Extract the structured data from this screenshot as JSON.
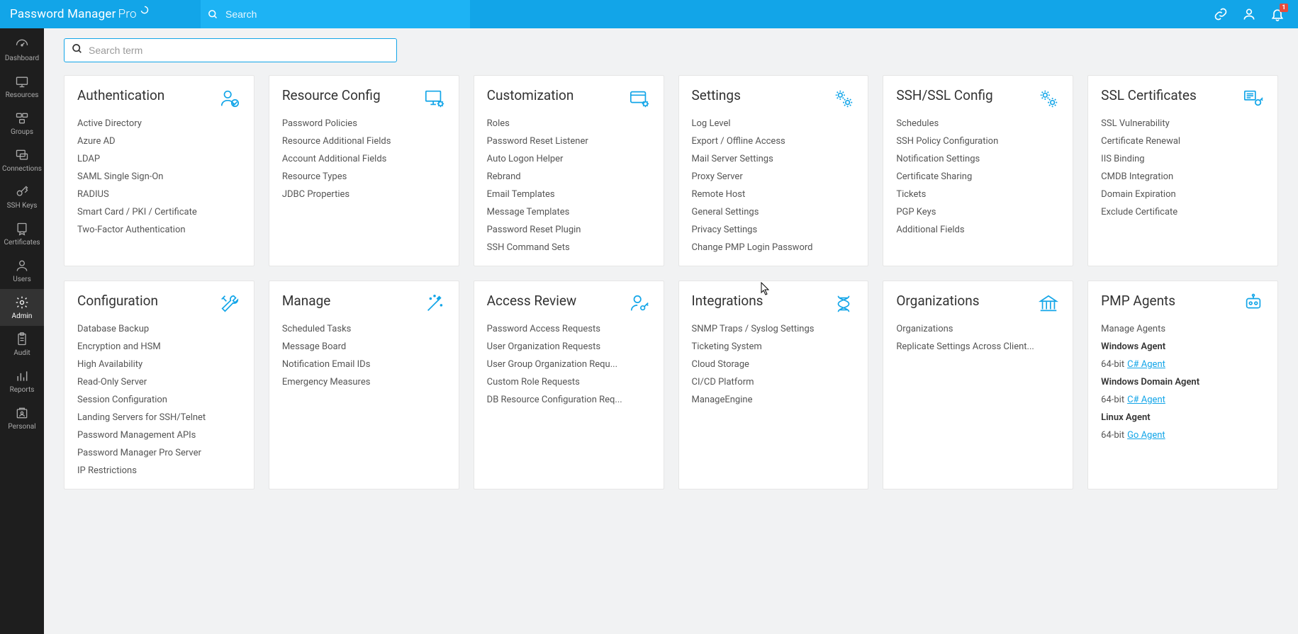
{
  "brand": {
    "name": "Password Manager",
    "suffix": "Pro"
  },
  "topSearch": {
    "placeholder": "Search"
  },
  "pageSearch": {
    "placeholder": "Search term"
  },
  "notifications": {
    "count": "1"
  },
  "sidebar": {
    "items": [
      {
        "label": "Dashboard"
      },
      {
        "label": "Resources"
      },
      {
        "label": "Groups"
      },
      {
        "label": "Connections"
      },
      {
        "label": "SSH Keys"
      },
      {
        "label": "Certificates"
      },
      {
        "label": "Users"
      },
      {
        "label": "Admin"
      },
      {
        "label": "Audit"
      },
      {
        "label": "Reports"
      },
      {
        "label": "Personal"
      }
    ],
    "activeIndex": 7
  },
  "cards": [
    {
      "title": "Authentication",
      "icon": "user-check-icon",
      "links": [
        "Active Directory",
        "Azure AD",
        "LDAP",
        "SAML Single Sign-On",
        "RADIUS",
        "Smart Card / PKI / Certificate",
        "Two-Factor Authentication"
      ]
    },
    {
      "title": "Resource Config",
      "icon": "monitor-gear-icon",
      "links": [
        "Password Policies",
        "Resource Additional Fields",
        "Account Additional Fields",
        "Resource Types",
        "JDBC Properties"
      ]
    },
    {
      "title": "Customization",
      "icon": "card-gear-icon",
      "links": [
        "Roles",
        "Password Reset Listener",
        "Auto Logon Helper",
        "Rebrand",
        "Email Templates",
        "Message Templates",
        "Password Reset Plugin",
        "SSH Command Sets"
      ]
    },
    {
      "title": "Settings",
      "icon": "gears-icon",
      "links": [
        "Log Level",
        "Export / Offline Access",
        "Mail Server Settings",
        "Proxy Server",
        "Remote Host",
        "General Settings",
        "Privacy Settings",
        "Change PMP Login Password"
      ]
    },
    {
      "title": "SSH/SSL Config",
      "icon": "gears-icon",
      "links": [
        "Schedules",
        "SSH Policy Configuration",
        "Notification Settings",
        "Certificate Sharing",
        "Tickets",
        "PGP Keys",
        "Additional Fields"
      ]
    },
    {
      "title": "SSL Certificates",
      "icon": "certificate-key-icon",
      "links": [
        "SSL Vulnerability",
        "Certificate Renewal",
        "IIS Binding",
        "CMDB Integration",
        "Domain Expiration",
        "Exclude Certificate"
      ]
    },
    {
      "title": "Configuration",
      "icon": "tools-icon",
      "links": [
        "Database Backup",
        "Encryption and HSM",
        "High Availability",
        "Read-Only Server",
        "Session Configuration",
        "Landing Servers for SSH/Telnet",
        "Password Management APIs",
        "Password Manager Pro Server",
        "IP Restrictions"
      ]
    },
    {
      "title": "Manage",
      "icon": "wand-icon",
      "links": [
        "Scheduled Tasks",
        "Message Board",
        "Notification Email IDs",
        "Emergency Measures"
      ]
    },
    {
      "title": "Access Review",
      "icon": "user-key-icon",
      "links": [
        "Password Access Requests",
        "User Organization Requests",
        "User Group Organization Requ...",
        "Custom Role Requests",
        "DB Resource Configuration Req..."
      ]
    },
    {
      "title": "Integrations",
      "icon": "dna-icon",
      "links": [
        "SNMP Traps / Syslog Settings",
        "Ticketing System",
        "Cloud Storage",
        "CI/CD Platform",
        "ManageEngine"
      ]
    },
    {
      "title": "Organizations",
      "icon": "bank-icon",
      "links": [
        "Organizations",
        "Replicate Settings Across Client..."
      ]
    },
    {
      "title": "PMP Agents",
      "icon": "agent-icon",
      "agents": {
        "manage": "Manage Agents",
        "sections": [
          {
            "heading": "Windows Agent",
            "arch": "64-bit",
            "link": "C# Agent"
          },
          {
            "heading": "Windows Domain Agent",
            "arch": "64-bit",
            "link": "C# Agent"
          },
          {
            "heading": "Linux Agent",
            "arch": "64-bit",
            "link": "Go Agent"
          }
        ]
      }
    }
  ]
}
